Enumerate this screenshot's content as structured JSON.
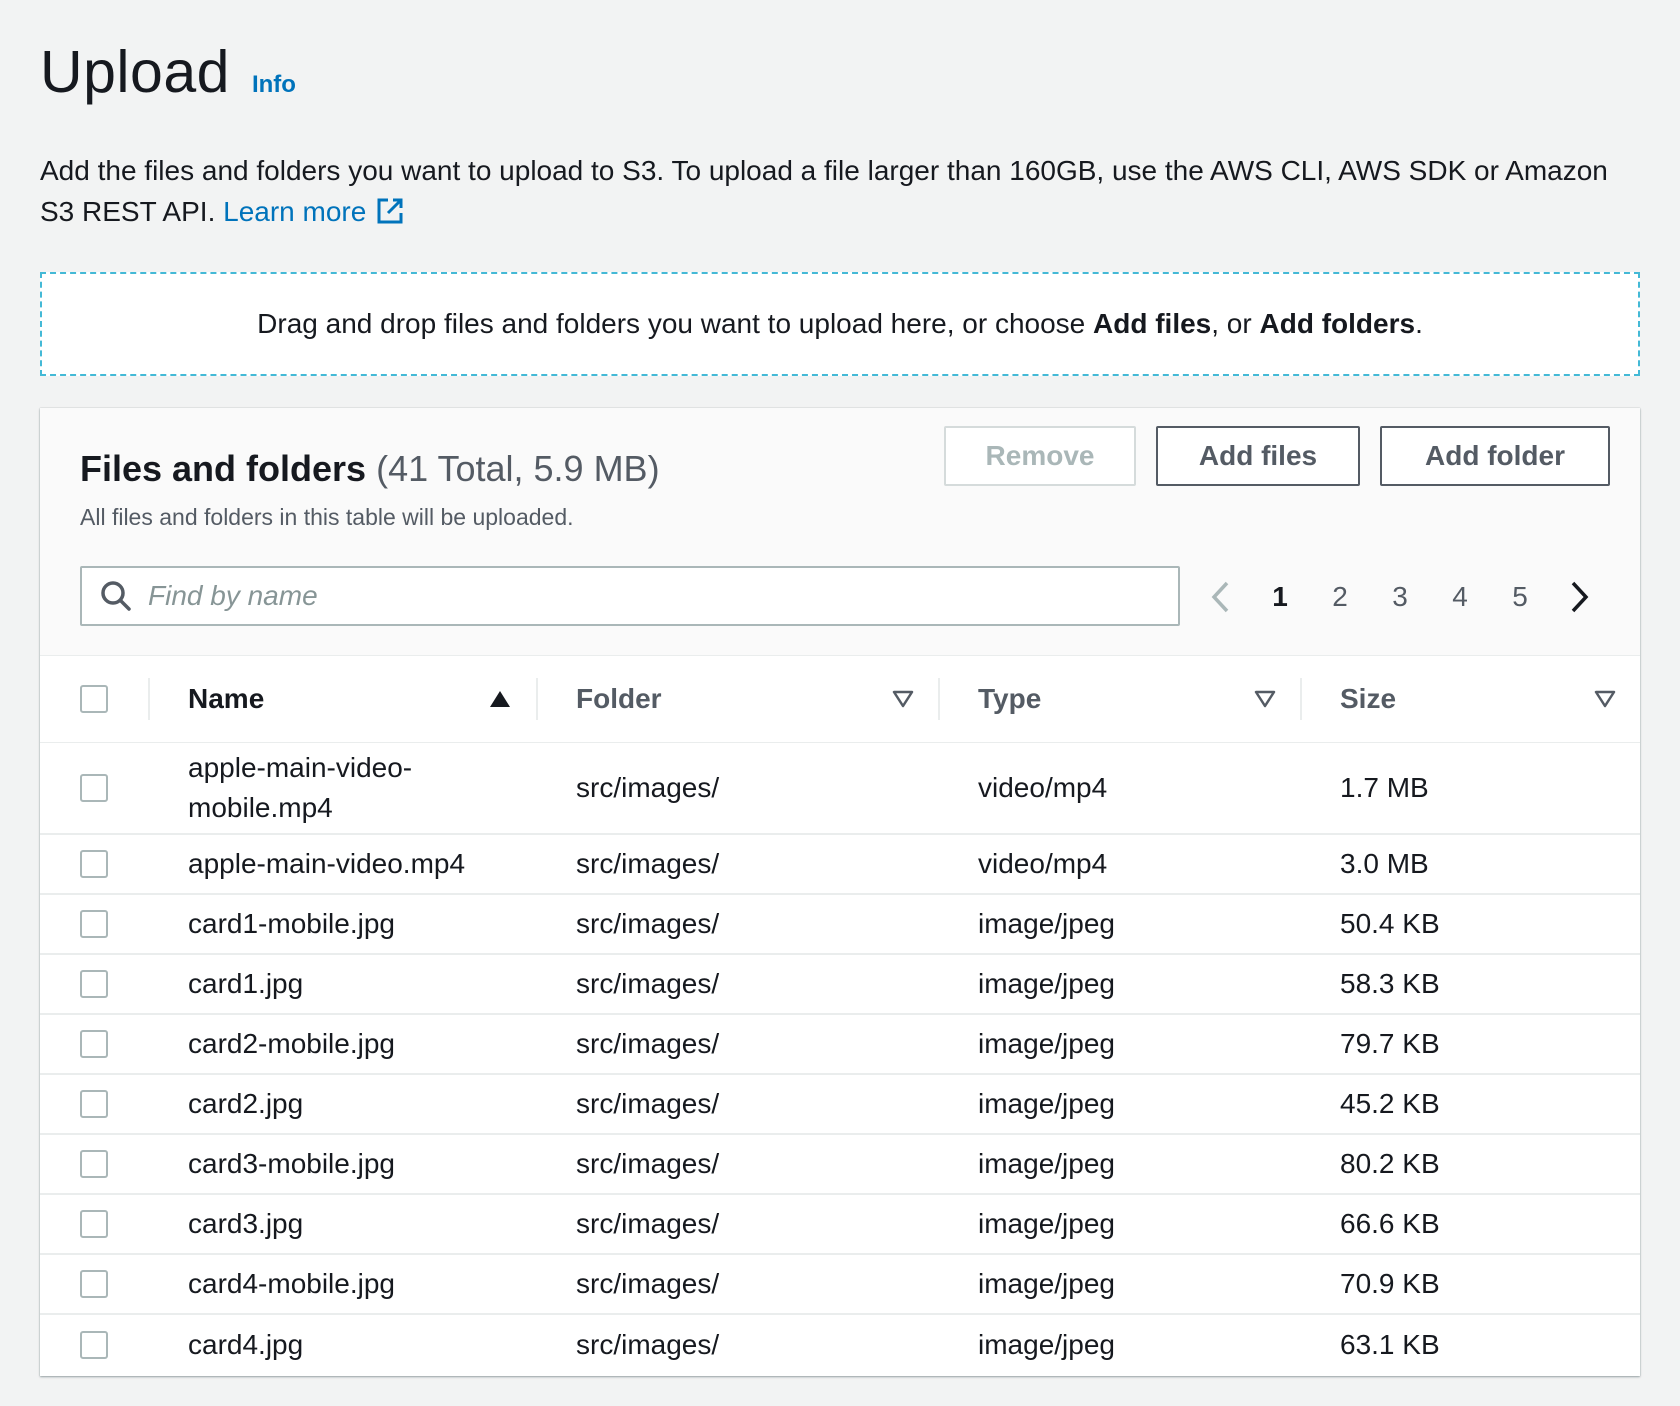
{
  "page": {
    "title": "Upload",
    "info_link": "Info",
    "description": "Add the files and folders you want to upload to S3. To upload a file larger than 160GB, use the AWS CLI, AWS SDK or Amazon S3 REST API.",
    "learn_more": "Learn more",
    "icons": {
      "external": "external-link-icon"
    },
    "accent_color": "#0073bb"
  },
  "dropzone": {
    "text_before": "Drag and drop files and folders you want to upload here, or choose",
    "add_files": "Add files",
    "middle": ", or",
    "add_folders": "Add folders",
    "end": "."
  },
  "panel": {
    "title": "Files and folders",
    "count": "(41 Total, 5.9 MB)",
    "subtitle": "All files and folders in this table will be uploaded.",
    "buttons": {
      "remove": "Remove",
      "add_files": "Add files",
      "add_folder": "Add folder"
    },
    "search": {
      "placeholder": "Find by name",
      "icon": "search-icon"
    },
    "pagination": {
      "pages": [
        "1",
        "2",
        "3",
        "4",
        "5"
      ],
      "current": "1"
    }
  },
  "table": {
    "columns": [
      {
        "label": "Name",
        "sort": "ascending"
      },
      {
        "label": "Folder",
        "sort": "none"
      },
      {
        "label": "Type",
        "sort": "none"
      },
      {
        "label": "Size",
        "sort": "none"
      }
    ],
    "rows": [
      {
        "name": "apple-main-video-mobile.mp4",
        "folder": "src/images/",
        "type": "video/mp4",
        "size": "1.7 MB"
      },
      {
        "name": "apple-main-video.mp4",
        "folder": "src/images/",
        "type": "video/mp4",
        "size": "3.0 MB"
      },
      {
        "name": "card1-mobile.jpg",
        "folder": "src/images/",
        "type": "image/jpeg",
        "size": "50.4 KB"
      },
      {
        "name": "card1.jpg",
        "folder": "src/images/",
        "type": "image/jpeg",
        "size": "58.3 KB"
      },
      {
        "name": "card2-mobile.jpg",
        "folder": "src/images/",
        "type": "image/jpeg",
        "size": "79.7 KB"
      },
      {
        "name": "card2.jpg",
        "folder": "src/images/",
        "type": "image/jpeg",
        "size": "45.2 KB"
      },
      {
        "name": "card3-mobile.jpg",
        "folder": "src/images/",
        "type": "image/jpeg",
        "size": "80.2 KB"
      },
      {
        "name": "card3.jpg",
        "folder": "src/images/",
        "type": "image/jpeg",
        "size": "66.6 KB"
      },
      {
        "name": "card4-mobile.jpg",
        "folder": "src/images/",
        "type": "image/jpeg",
        "size": "70.9 KB"
      },
      {
        "name": "card4.jpg",
        "folder": "src/images/",
        "type": "image/jpeg",
        "size": "63.1 KB"
      }
    ]
  }
}
